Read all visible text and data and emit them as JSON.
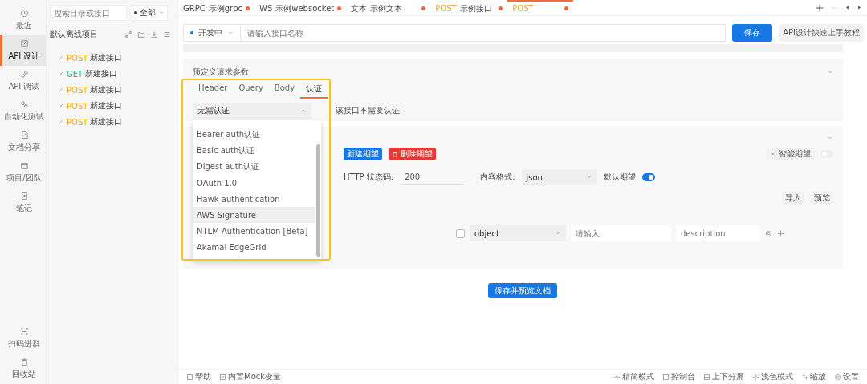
{
  "rail": {
    "items": [
      {
        "label": "最近",
        "kind": "clock",
        "selected": false
      },
      {
        "label": "API 设计",
        "kind": "edit",
        "selected": true
      },
      {
        "label": "API 调试",
        "kind": "link",
        "selected": false
      },
      {
        "label": "自动化测试",
        "kind": "flow",
        "selected": false
      },
      {
        "label": "文档分享",
        "kind": "doc",
        "selected": false
      },
      {
        "label": "项目/团队",
        "kind": "box",
        "selected": false
      },
      {
        "label": "笔记",
        "kind": "note",
        "selected": false
      }
    ],
    "bottom": [
      {
        "label": "扫码进群",
        "kind": "scan"
      },
      {
        "label": "回收站",
        "kind": "trash"
      }
    ]
  },
  "tree": {
    "search_placeholder": "搜索目录或接口",
    "filter": "全部",
    "project": "默认离线项目",
    "items": [
      {
        "method": "POST",
        "color": "#f5a623",
        "name": "新建接口"
      },
      {
        "method": "GET",
        "color": "#27b47a",
        "name": "新建接口"
      },
      {
        "method": "POST",
        "color": "#f5a623",
        "name": "新建接口"
      },
      {
        "method": "POST",
        "color": "#f5a623",
        "name": "新建接口"
      },
      {
        "method": "POST",
        "color": "#f5a623",
        "name": "新建接口"
      }
    ]
  },
  "tabs": [
    {
      "method": "GRPC",
      "name": "示例grpc",
      "selected": false
    },
    {
      "method": "WS",
      "name": "示例websocket",
      "selected": false
    },
    {
      "method": "文本",
      "name": "示例文本",
      "selected": false
    },
    {
      "method": "POST",
      "color": "#f5a623",
      "name": "示例接口",
      "selected": false
    },
    {
      "method": "POST",
      "color": "#f5a623",
      "selected": true
    }
  ],
  "url_bar": {
    "env": "开发中",
    "placeholder": "请输入接口名称",
    "save": "保存",
    "tutorial": "API设计快速上手教程"
  },
  "params_card": {
    "title": "预定义请求参数",
    "tabs": [
      {
        "label": "Header",
        "selected": false
      },
      {
        "label": "Query",
        "selected": false
      },
      {
        "label": "Body",
        "selected": false
      },
      {
        "label": "认证",
        "selected": true
      }
    ],
    "auth_select": "无需认证",
    "auth_note": "该接口不需要认证",
    "options": [
      {
        "label": "Bearer auth认证",
        "selected": false
      },
      {
        "label": "Basic auth认证",
        "selected": false
      },
      {
        "label": "Digest auth认证",
        "selected": false
      },
      {
        "label": "OAuth 1.0",
        "selected": false
      },
      {
        "label": "Hawk authentication",
        "selected": false
      },
      {
        "label": "AWS Signature",
        "selected": true
      },
      {
        "label": "NTLM Authentication [Beta]",
        "selected": false
      },
      {
        "label": "Akamai EdgeGrid",
        "selected": false
      }
    ]
  },
  "expect_card": {
    "new_button": "新建期望",
    "delete_button": "删除期望",
    "smart": "智能期望",
    "smart_on": false,
    "status_label": "HTTP 状态码:",
    "status": "200",
    "format_label": "内容格式:",
    "format": "json",
    "default_label": "默认期望",
    "default_on": true,
    "import": "导入",
    "preview": "预览",
    "field_type": "object",
    "field_placeholder": "请输入",
    "desc_placeholder": "description",
    "required": false
  },
  "save_preview": "保存并预览文档",
  "footer": {
    "left": [
      {
        "label": "帮助",
        "kind": "panel"
      },
      {
        "label": "内置Mock变量",
        "kind": "var"
      }
    ],
    "right": [
      {
        "label": "精简模式",
        "kind": "sun"
      },
      {
        "label": "控制台",
        "kind": "panel"
      },
      {
        "label": "上下分屏",
        "kind": "split"
      },
      {
        "label": "浅色模式",
        "kind": "sun"
      },
      {
        "label": "缩放",
        "kind": "text"
      },
      {
        "label": "设置",
        "kind": "gear"
      }
    ]
  }
}
